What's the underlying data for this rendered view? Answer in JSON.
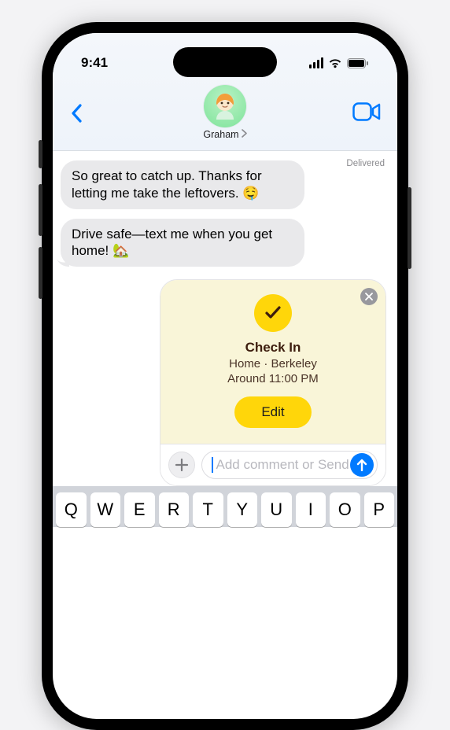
{
  "status": {
    "time": "9:41"
  },
  "header": {
    "contact_name": "Graham"
  },
  "thread": {
    "delivered_label": "Delivered",
    "messages": [
      {
        "text": "So great to catch up. Thanks for letting me take the leftovers. 🤤"
      },
      {
        "text": "Drive safe—text me when you get home! 🏡"
      }
    ]
  },
  "checkin": {
    "title": "Check In",
    "subtitle_line1": "Home · Berkeley",
    "subtitle_line2": "Around 11:00 PM",
    "edit_label": "Edit"
  },
  "compose": {
    "placeholder": "Add comment or Send"
  },
  "keyboard": {
    "row1": [
      "Q",
      "W",
      "E",
      "R",
      "T",
      "Y",
      "U",
      "I",
      "O",
      "P"
    ]
  }
}
